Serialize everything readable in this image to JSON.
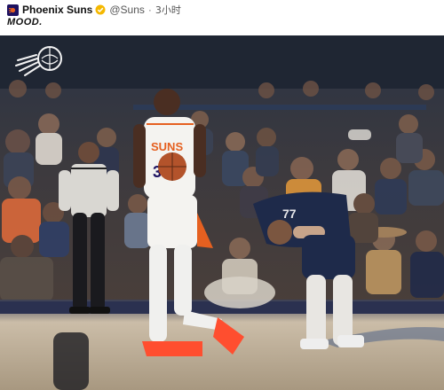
{
  "post": {
    "author_name": "Phoenix Suns",
    "handle": "@Suns",
    "separator": "·",
    "timestamp": "3小时",
    "caption": "MOOD.",
    "avatar_icon": "suns-logo-icon",
    "badge_icon": "verified-badge-icon"
  },
  "photo": {
    "watermark_icon": "suns-sunburst-logo-icon",
    "jersey_number_left": "35",
    "jersey_number_right": "77",
    "jersey_wordmark": "SUNS",
    "colors": {
      "suns_purple": "#1d1160",
      "suns_orange": "#e56020",
      "mavs_navy": "#1e2a4a",
      "court": "#c7b9a4"
    }
  }
}
